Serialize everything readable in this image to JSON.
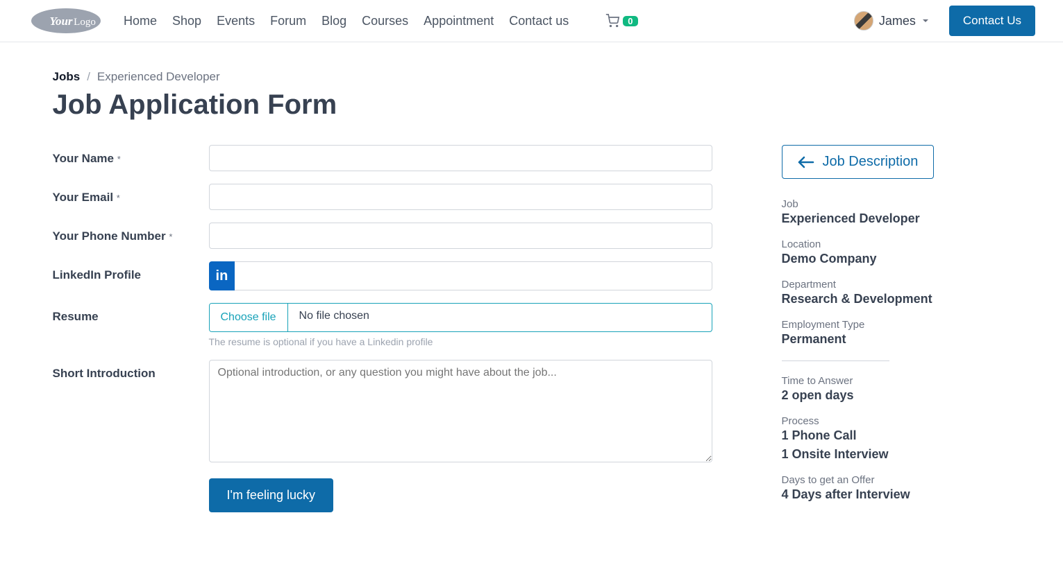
{
  "header": {
    "nav": {
      "home": "Home",
      "shop": "Shop",
      "events": "Events",
      "forum": "Forum",
      "blog": "Blog",
      "courses": "Courses",
      "appointment": "Appointment",
      "contact": "Contact us"
    },
    "cart_count": "0",
    "user_name": "James",
    "contact_btn": "Contact Us"
  },
  "breadcrumb": {
    "root": "Jobs",
    "sep": "/",
    "current": "Experienced Developer"
  },
  "page_title": "Job Application Form",
  "form": {
    "name_label": "Your Name",
    "email_label": "Your Email",
    "phone_label": "Your Phone Number",
    "linkedin_label": "LinkedIn Profile",
    "resume_label": "Resume",
    "file_btn": "Choose file",
    "file_text": "No file chosen",
    "resume_help": "The resume is optional if you have a Linkedin profile",
    "intro_label": "Short Introduction",
    "intro_placeholder": "Optional introduction, or any question you might have about the job...",
    "submit": "I'm feeling lucky",
    "req": "*"
  },
  "sidebar": {
    "jd_btn": "Job Description",
    "job_label": "Job",
    "job_value": "Experienced Developer",
    "location_label": "Location",
    "location_value": "Demo Company",
    "dept_label": "Department",
    "dept_value": "Research & Development",
    "emp_label": "Employment Type",
    "emp_value": "Permanent",
    "tta_label": "Time to Answer",
    "tta_value": "2 open days",
    "process_label": "Process",
    "process_value1": "1 Phone Call",
    "process_value2": "1 Onsite Interview",
    "offer_label": "Days to get an Offer",
    "offer_value": "4 Days after Interview"
  }
}
